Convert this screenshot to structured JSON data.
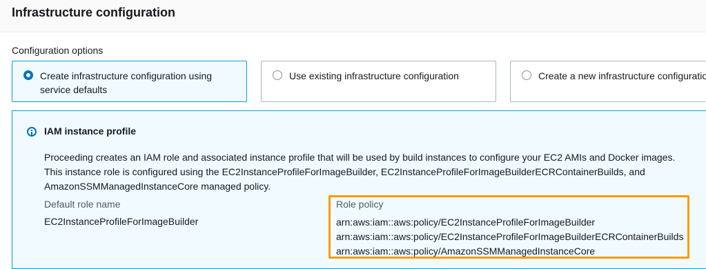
{
  "header": {
    "title": "Infrastructure configuration"
  },
  "config": {
    "label": "Configuration options",
    "options": [
      {
        "label": "Create infrastructure configuration using service defaults",
        "selected": true
      },
      {
        "label": "Use existing infrastructure configuration",
        "selected": false
      },
      {
        "label": "Create a new infrastructure configuration",
        "selected": false
      }
    ]
  },
  "alert": {
    "icon": "info-icon",
    "title": "IAM instance profile",
    "body": "Proceeding creates an IAM role and associated instance profile that will be used by build instances to configure your EC2 AMIs and Docker images. This instance role is configured using the EC2InstanceProfileForImageBuilder, EC2InstanceProfileForImageBuilderECRContainerBuilds, and AmazonSSMManagedInstanceCore managed policy.",
    "default_role_label": "Default role name",
    "default_role_value": "EC2InstanceProfileForImageBuilder",
    "role_policy_label": "Role policy",
    "policies": [
      "arn:aws:iam::aws:policy/EC2InstanceProfileForImageBuilder",
      "arn:aws:iam::aws:policy/EC2InstanceProfileForImageBuilderECRContainerBuilds",
      "arn:aws:iam::aws:policy/AmazonSSMManagedInstanceCore"
    ]
  },
  "colors": {
    "accent": "#0073bb",
    "info_border": "#00a1c9",
    "highlight": "#ff9900"
  }
}
